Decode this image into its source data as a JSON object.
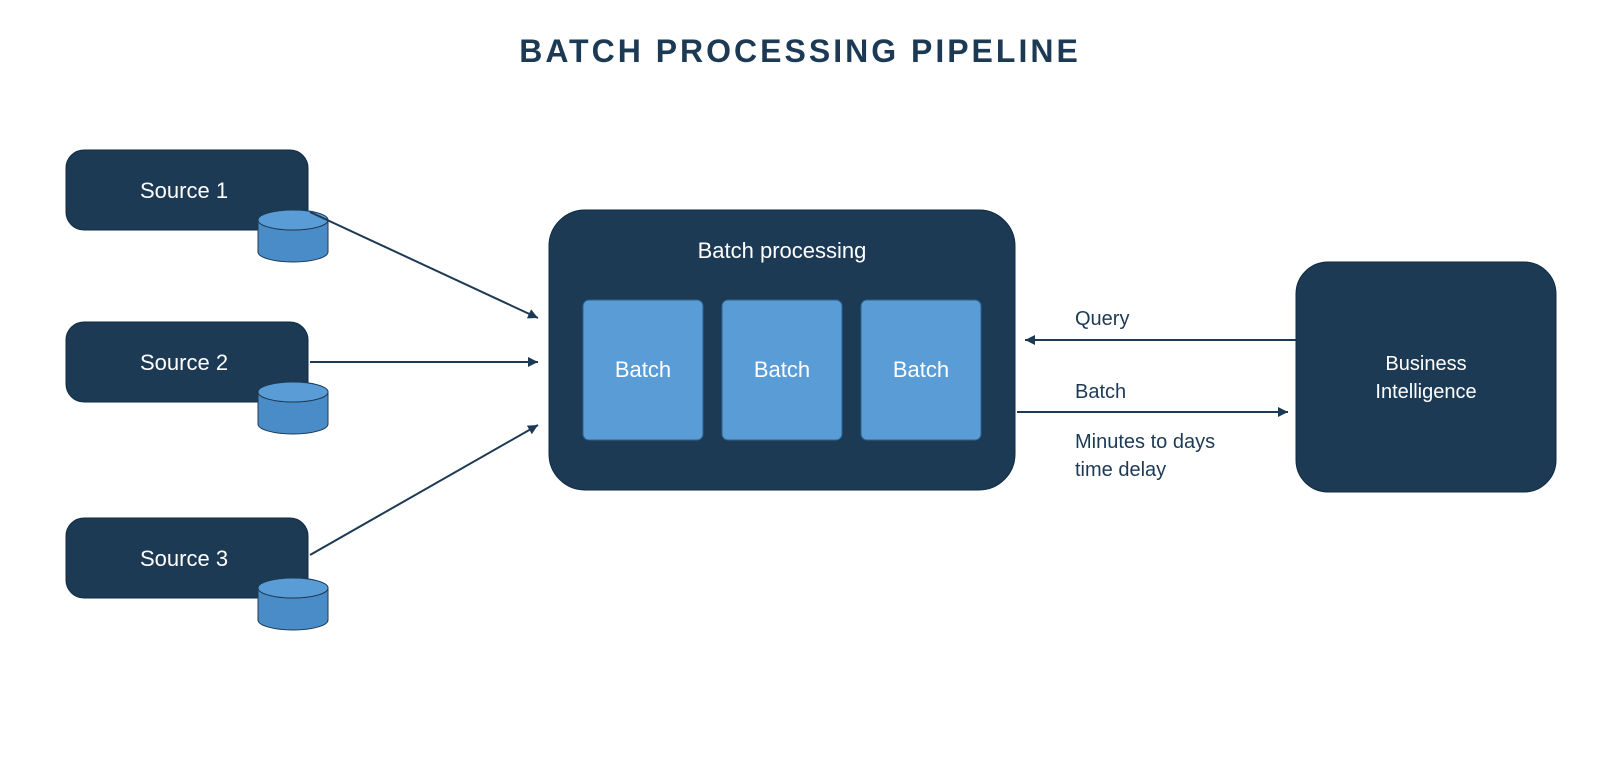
{
  "title": "BATCH PROCESSING PIPELINE",
  "sources": [
    {
      "label": "Source 1"
    },
    {
      "label": "Source 2"
    },
    {
      "label": "Source 3"
    }
  ],
  "processor": {
    "title": "Batch processing",
    "units": [
      "Batch",
      "Batch",
      "Batch"
    ]
  },
  "edges": {
    "query": "Query",
    "batch": "Batch",
    "delay_line1": "Minutes to days",
    "delay_line2": "time delay"
  },
  "sink": {
    "line1": "Business",
    "line2": "Intelligence"
  }
}
